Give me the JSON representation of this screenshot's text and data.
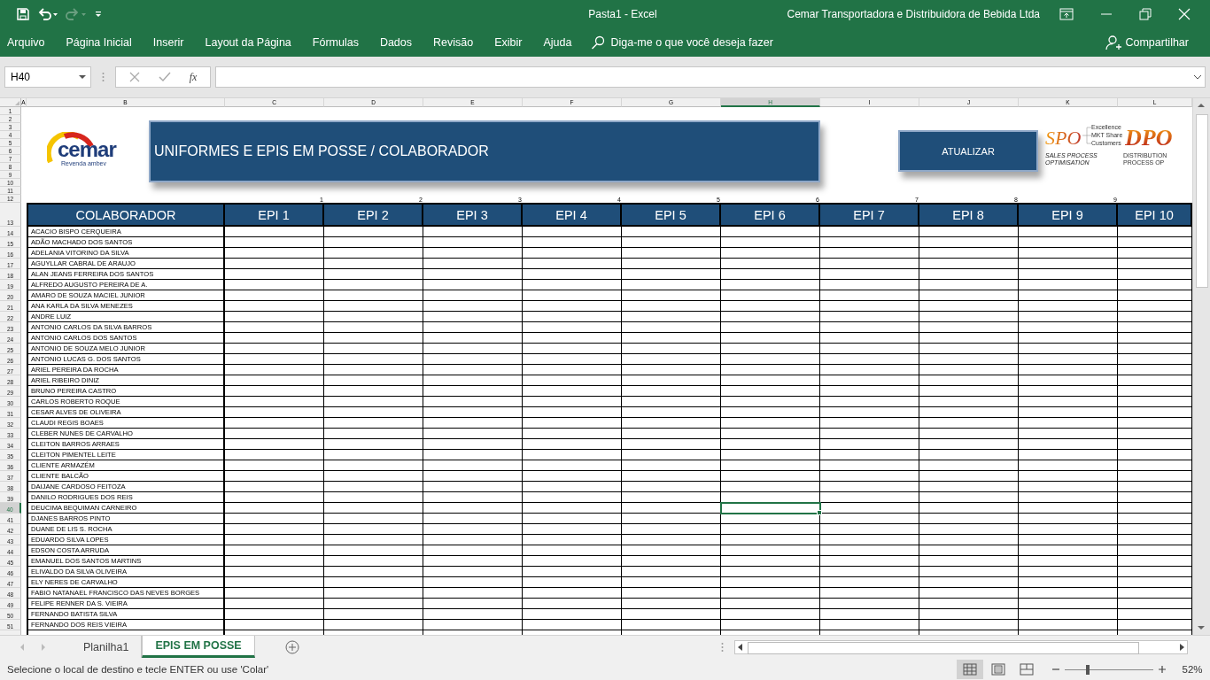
{
  "window": {
    "title": "Pasta1  -  Excel",
    "account": "Cemar Transportadora e Distribuidora de Bebida Ltda"
  },
  "ribbon_tabs": [
    "Arquivo",
    "Página Inicial",
    "Inserir",
    "Layout da Página",
    "Fórmulas",
    "Dados",
    "Revisão",
    "Exibir",
    "Ajuda"
  ],
  "tell_me": "Diga-me o que você deseja fazer",
  "share": "Compartilhar",
  "formula_bar": {
    "name_box": "H40",
    "function_label": "fx"
  },
  "columns": [
    {
      "label": "A",
      "selected": false
    },
    {
      "label": "B",
      "selected": false
    },
    {
      "label": "C",
      "selected": false
    },
    {
      "label": "D",
      "selected": false
    },
    {
      "label": "E",
      "selected": false
    },
    {
      "label": "F",
      "selected": false
    },
    {
      "label": "G",
      "selected": false
    },
    {
      "label": "H",
      "selected": true
    },
    {
      "label": "I",
      "selected": false
    },
    {
      "label": "J",
      "selected": false
    },
    {
      "label": "K",
      "selected": false
    },
    {
      "label": "L",
      "selected": false
    }
  ],
  "top_rows": [
    "1",
    "2",
    "3",
    "4",
    "5",
    "6",
    "7",
    "8",
    "9",
    "10",
    "11",
    "12",
    "13"
  ],
  "logos": {
    "cemar": {
      "name": "cemar",
      "tagline": "Revenda ambev"
    },
    "spo": {
      "name": "SPO",
      "tagline": "SALES PROCESS OPTIMISATION",
      "branches": [
        "Excellence",
        "MKT Share",
        "Customers"
      ]
    },
    "dpo": {
      "name": "DPO",
      "tagline": "DISTRIBUTION PROCESS OP"
    }
  },
  "sheet_title": "UNIFORMES E EPIS EM POSSE / COLABORADOR",
  "update_button": "ATUALIZAR",
  "table": {
    "index_numbers": [
      "1",
      "2",
      "3",
      "4",
      "5",
      "6",
      "7",
      "8",
      "9"
    ],
    "header": [
      "COLABORADOR",
      "EPI 1",
      "EPI 2",
      "EPI 3",
      "EPI 4",
      "EPI 5",
      "EPI 6",
      "EPI 7",
      "EPI 8",
      "EPI 9",
      "EPI 10"
    ],
    "rows": [
      {
        "number": "14",
        "name": "ACACIO BISPO CERQUEIRA",
        "selected": false
      },
      {
        "number": "15",
        "name": "ADÃO MACHADO DOS SANTOS",
        "selected": false
      },
      {
        "number": "16",
        "name": "ADELANIA VITORINO DA SILVA",
        "selected": false
      },
      {
        "number": "17",
        "name": "AGUYLLAR CABRAL DE ARAUJO",
        "selected": false
      },
      {
        "number": "18",
        "name": "ALAN JEANS FERREIRA DOS SANTOS",
        "selected": false
      },
      {
        "number": "19",
        "name": "ALFREDO AUGUSTO PEREIRA DE A.",
        "selected": false
      },
      {
        "number": "20",
        "name": "AMARO DE SOUZA MACIEL JUNIOR",
        "selected": false
      },
      {
        "number": "21",
        "name": "ANA KARLA DA SILVA MENEZES",
        "selected": false
      },
      {
        "number": "22",
        "name": "ANDRE LUIZ",
        "selected": false
      },
      {
        "number": "23",
        "name": "ANTONIO CARLOS DA SILVA BARROS",
        "selected": false
      },
      {
        "number": "24",
        "name": "ANTONIO CARLOS DOS SANTOS",
        "selected": false
      },
      {
        "number": "25",
        "name": "ANTONIO DE SOUZA MELO JUNIOR",
        "selected": false
      },
      {
        "number": "26",
        "name": "ANTONIO LUCAS G. DOS SANTOS",
        "selected": false
      },
      {
        "number": "27",
        "name": "ARIEL PEREIRA DA ROCHA",
        "selected": false
      },
      {
        "number": "28",
        "name": "ARIEL RIBEIRO DINIZ",
        "selected": false
      },
      {
        "number": "29",
        "name": "BRUNO PEREIRA CASTRO",
        "selected": false
      },
      {
        "number": "30",
        "name": "CARLOS ROBERTO ROQUE",
        "selected": false
      },
      {
        "number": "31",
        "name": "CESAR ALVES DE OLIVEIRA",
        "selected": false
      },
      {
        "number": "32",
        "name": "CLAUDI REGIS BOAES",
        "selected": false
      },
      {
        "number": "33",
        "name": "CLEBER NUNES DE CARVALHO",
        "selected": false
      },
      {
        "number": "34",
        "name": "CLEITON BARROS ARRAES",
        "selected": false
      },
      {
        "number": "35",
        "name": "CLEITON PIMENTEL LEITE",
        "selected": false
      },
      {
        "number": "36",
        "name": "CLIENTE  ARMAZÉM",
        "selected": false
      },
      {
        "number": "37",
        "name": "CLIENTE BALCÃO",
        "selected": false
      },
      {
        "number": "38",
        "name": "DAIJANE CARDOSO FEITOZA",
        "selected": false
      },
      {
        "number": "39",
        "name": "DANILO RODRIGUES DOS REIS",
        "selected": false
      },
      {
        "number": "40",
        "name": "DEUCIMA BEQUIMAN CARNEIRO",
        "selected": true
      },
      {
        "number": "41",
        "name": "DJANES BARROS PINTO",
        "selected": false
      },
      {
        "number": "42",
        "name": "DUANE DE LIS S. ROCHA",
        "selected": false
      },
      {
        "number": "43",
        "name": "EDUARDO SILVA LOPES",
        "selected": false
      },
      {
        "number": "44",
        "name": "EDSON COSTA ARRUDA",
        "selected": false
      },
      {
        "number": "45",
        "name": "EMANUEL DOS SANTOS MARTINS",
        "selected": false
      },
      {
        "number": "46",
        "name": "ELIVALDO DA SILVA OLIVEIRA",
        "selected": false
      },
      {
        "number": "47",
        "name": "ELY NERES DE CARVALHO",
        "selected": false
      },
      {
        "number": "48",
        "name": "FABIO NATANAEL FRANCISCO DAS NEVES BORGES",
        "selected": false
      },
      {
        "number": "49",
        "name": "FELIPE RENNER DA S. VIEIRA",
        "selected": false
      },
      {
        "number": "50",
        "name": "FERNANDO BATISTA SILVA",
        "selected": false
      },
      {
        "number": "51",
        "name": "FERNANDO DOS REIS VIEIRA",
        "selected": false
      }
    ]
  },
  "sheet_tabs": [
    {
      "label": "Planilha1",
      "selected": false
    },
    {
      "label": "EPIS EM POSSE",
      "selected": true
    }
  ],
  "status": "Selecione o local de destino e tecle ENTER ou use 'Colar'",
  "views": [
    {
      "kind": "normal",
      "selected": true
    },
    {
      "kind": "layout",
      "selected": false
    },
    {
      "kind": "pagebreak",
      "selected": false
    }
  ],
  "zoom": {
    "level": 0.26,
    "reading": "52%"
  }
}
